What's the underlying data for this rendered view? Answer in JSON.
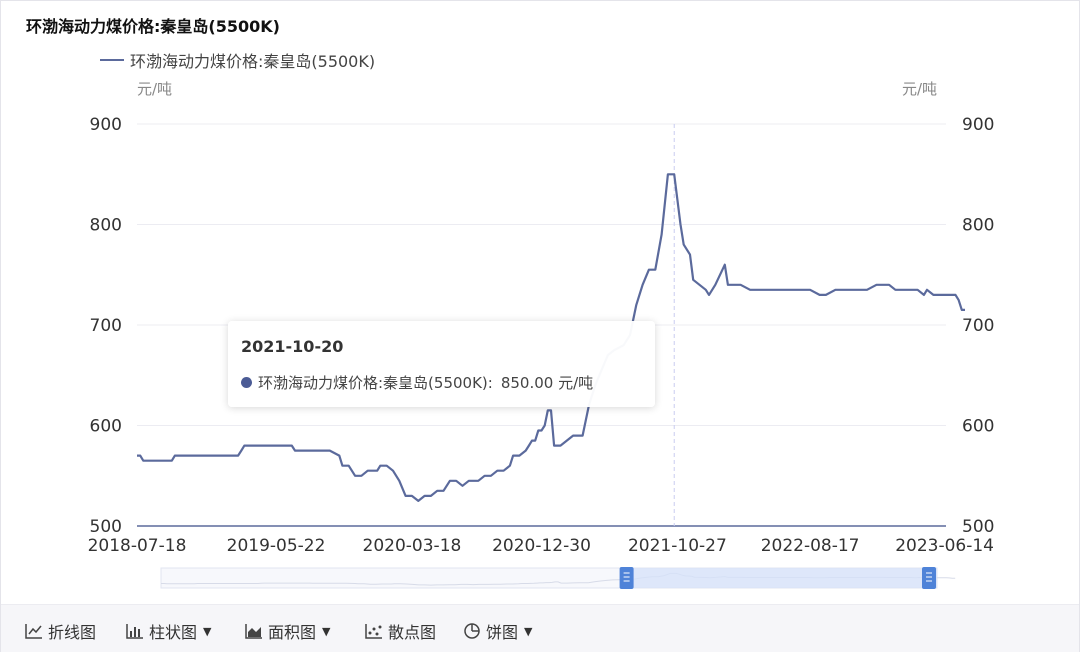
{
  "title": "环渤海动力煤价格:秦皇岛(5500K)",
  "legend_label": "环渤海动力煤价格:秦皇岛(5500K)",
  "left_unit": "元/吨",
  "right_unit": "元/吨",
  "colors": {
    "line": "#5b6a9c",
    "grid": "#ececf2",
    "axis_text": "#333333",
    "crosshair": "#c9cdf0",
    "zoom_fill": "#d6e2fa",
    "zoom_handle": "#4f83d8",
    "tooltip_dot": "#4b5b95"
  },
  "tooltip": {
    "date": "2021-10-20",
    "series": "环渤海动力煤价格:秦皇岛(5500K)",
    "separator": ":",
    "value": "850.00 元/吨"
  },
  "toolbar": [
    {
      "label": "折线图",
      "icon": "line-chart-icon",
      "caret": false
    },
    {
      "label": "柱状图",
      "icon": "bar-chart-icon",
      "caret": true
    },
    {
      "label": "面积图",
      "icon": "area-chart-icon",
      "caret": true
    },
    {
      "label": "散点图",
      "icon": "scatter-chart-icon",
      "caret": false
    },
    {
      "label": "饼图",
      "icon": "pie-chart-icon",
      "caret": true
    }
  ],
  "zoom_slider": {
    "start_fraction": 0.6,
    "end_fraction": 1.0
  },
  "chart_data": {
    "type": "line",
    "title": "环渤海动力煤价格:秦皇岛(5500K)",
    "xlabel": "",
    "ylabel": "元/吨",
    "ylim": [
      500,
      900
    ],
    "y_ticks": [
      500,
      600,
      700,
      800,
      900
    ],
    "x_tick_labels": [
      "2018-07-18",
      "2019-05-22",
      "2020-03-18",
      "2020-12-30",
      "2021-10-27",
      "2022-08-17",
      "2023-06-14"
    ],
    "grid": true,
    "legend_position": "top-left",
    "highlight_date": "2021-10-20",
    "series": [
      {
        "name": "环渤海动力煤价格:秦皇岛(5500K)",
        "points": [
          [
            "2018-07-18",
            570
          ],
          [
            "2018-07-25",
            570
          ],
          [
            "2018-08-01",
            565
          ],
          [
            "2018-09-19",
            565
          ],
          [
            "2018-10-03",
            565
          ],
          [
            "2018-10-10",
            570
          ],
          [
            "2018-12-12",
            570
          ],
          [
            "2019-01-09",
            570
          ],
          [
            "2019-02-27",
            570
          ],
          [
            "2019-03-06",
            575
          ],
          [
            "2019-03-13",
            580
          ],
          [
            "2019-04-24",
            580
          ],
          [
            "2019-05-22",
            580
          ],
          [
            "2019-06-26",
            580
          ],
          [
            "2019-07-03",
            575
          ],
          [
            "2019-08-14",
            575
          ],
          [
            "2019-09-18",
            575
          ],
          [
            "2019-10-09",
            570
          ],
          [
            "2019-10-16",
            560
          ],
          [
            "2019-10-30",
            560
          ],
          [
            "2019-11-13",
            550
          ],
          [
            "2019-11-27",
            550
          ],
          [
            "2019-12-11",
            555
          ],
          [
            "2020-01-01",
            555
          ],
          [
            "2020-01-08",
            560
          ],
          [
            "2020-01-22",
            560
          ],
          [
            "2020-02-05",
            555
          ],
          [
            "2020-02-19",
            545
          ],
          [
            "2020-03-04",
            530
          ],
          [
            "2020-03-18",
            530
          ],
          [
            "2020-04-01",
            525
          ],
          [
            "2020-04-15",
            530
          ],
          [
            "2020-04-29",
            530
          ],
          [
            "2020-05-13",
            535
          ],
          [
            "2020-05-27",
            535
          ],
          [
            "2020-06-10",
            545
          ],
          [
            "2020-06-24",
            545
          ],
          [
            "2020-07-08",
            540
          ],
          [
            "2020-07-22",
            545
          ],
          [
            "2020-08-12",
            545
          ],
          [
            "2020-08-26",
            550
          ],
          [
            "2020-09-09",
            550
          ],
          [
            "2020-09-23",
            555
          ],
          [
            "2020-10-07",
            555
          ],
          [
            "2020-10-21",
            560
          ],
          [
            "2020-10-28",
            570
          ],
          [
            "2020-11-11",
            570
          ],
          [
            "2020-11-25",
            575
          ],
          [
            "2020-12-02",
            580
          ],
          [
            "2020-12-09",
            585
          ],
          [
            "2020-12-16",
            585
          ],
          [
            "2020-12-23",
            595
          ],
          [
            "2020-12-30",
            595
          ],
          [
            "2021-01-06",
            600
          ],
          [
            "2021-01-13",
            615
          ],
          [
            "2021-01-20",
            615
          ],
          [
            "2021-01-27",
            580
          ],
          [
            "2021-02-10",
            580
          ],
          [
            "2021-02-24",
            585
          ],
          [
            "2021-03-10",
            590
          ],
          [
            "2021-03-31",
            590
          ],
          [
            "2021-04-14",
            620
          ],
          [
            "2021-04-28",
            640
          ],
          [
            "2021-05-12",
            655
          ],
          [
            "2021-05-26",
            670
          ],
          [
            "2021-06-09",
            675
          ],
          [
            "2021-06-30",
            680
          ],
          [
            "2021-07-14",
            690
          ],
          [
            "2021-07-28",
            720
          ],
          [
            "2021-08-11",
            740
          ],
          [
            "2021-08-25",
            755
          ],
          [
            "2021-09-08",
            755
          ],
          [
            "2021-09-22",
            790
          ],
          [
            "2021-10-06",
            850
          ],
          [
            "2021-10-20",
            850
          ],
          [
            "2021-11-03",
            800
          ],
          [
            "2021-11-10",
            780
          ],
          [
            "2021-11-24",
            770
          ],
          [
            "2021-12-01",
            745
          ],
          [
            "2021-12-15",
            740
          ],
          [
            "2021-12-29",
            735
          ],
          [
            "2022-01-05",
            730
          ],
          [
            "2022-01-19",
            740
          ],
          [
            "2022-02-09",
            760
          ],
          [
            "2022-02-16",
            740
          ],
          [
            "2022-03-16",
            740
          ],
          [
            "2022-04-06",
            735
          ],
          [
            "2022-05-11",
            735
          ],
          [
            "2022-06-15",
            735
          ],
          [
            "2022-07-27",
            735
          ],
          [
            "2022-08-17",
            735
          ],
          [
            "2022-09-07",
            730
          ],
          [
            "2022-09-21",
            730
          ],
          [
            "2022-10-12",
            735
          ],
          [
            "2022-11-16",
            735
          ],
          [
            "2022-12-21",
            735
          ],
          [
            "2023-01-11",
            740
          ],
          [
            "2023-02-08",
            740
          ],
          [
            "2023-02-22",
            735
          ],
          [
            "2023-03-15",
            735
          ],
          [
            "2023-04-12",
            735
          ],
          [
            "2023-04-26",
            730
          ],
          [
            "2023-05-03",
            735
          ],
          [
            "2023-05-17",
            730
          ],
          [
            "2023-05-31",
            730
          ],
          [
            "2023-06-07",
            730
          ],
          [
            "2023-06-14",
            730
          ],
          [
            "2023-06-21",
            730
          ],
          [
            "2023-07-05",
            730
          ],
          [
            "2023-07-12",
            725
          ],
          [
            "2023-07-19",
            715
          ],
          [
            "2023-07-26",
            715
          ]
        ]
      }
    ]
  }
}
